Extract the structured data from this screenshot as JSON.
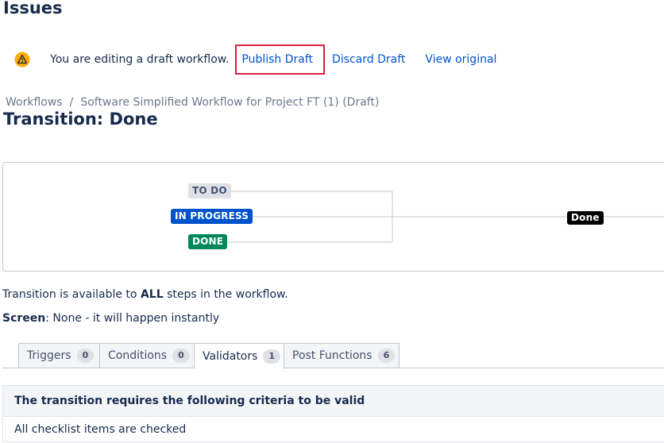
{
  "header": {
    "title": "Issues"
  },
  "draft_banner": {
    "message": "You are editing a draft workflow.",
    "publish_label": "Publish Draft",
    "discard_label": "Discard Draft",
    "view_label": "View original",
    "icon": "warning-icon"
  },
  "breadcrumb": {
    "items": [
      "Workflows",
      "Software Simplified Workflow for Project FT (1) (Draft)"
    ],
    "separator": "/"
  },
  "transition": {
    "title": "Transition: Done"
  },
  "diagram": {
    "statuses": [
      "TO DO",
      "IN PROGRESS",
      "DONE"
    ],
    "transition_label": "Done"
  },
  "info": {
    "availability_prefix": "Transition is available to ",
    "availability_bold": "ALL",
    "availability_suffix": " steps in the workflow.",
    "screen_label": "Screen",
    "screen_value": ": None - it will happen instantly"
  },
  "tabs": [
    {
      "label": "Triggers",
      "count": "0"
    },
    {
      "label": "Conditions",
      "count": "0"
    },
    {
      "label": "Validators",
      "count": "1"
    },
    {
      "label": "Post Functions",
      "count": "6"
    }
  ],
  "panel": {
    "heading": "The transition requires the following criteria to be valid",
    "rows": [
      "All checklist items are checked"
    ]
  },
  "colors": {
    "link": "#0052cc",
    "highlight": "#d9233f",
    "in_progress": "#0052cc",
    "done": "#00875a",
    "todo": "#dfe1e6"
  }
}
